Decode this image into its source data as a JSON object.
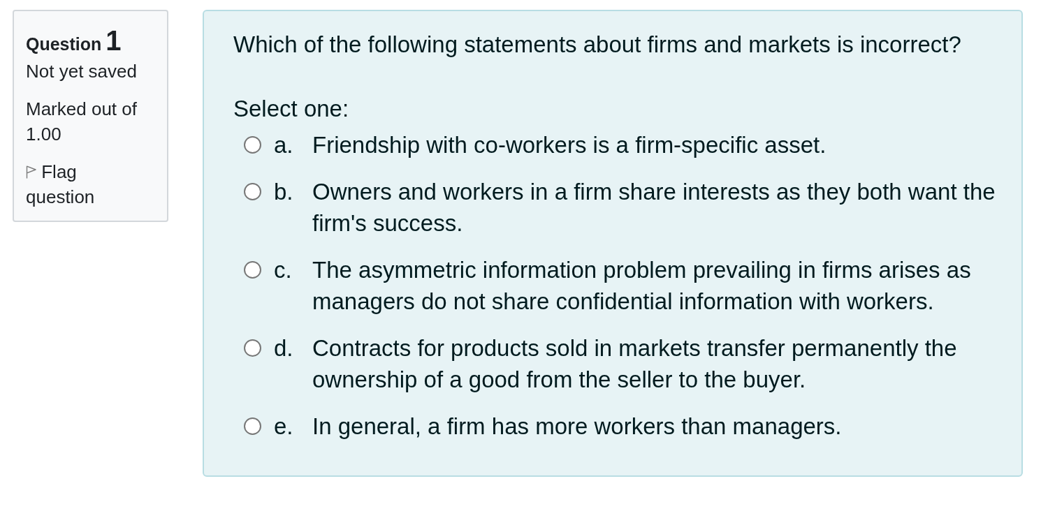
{
  "question_info": {
    "label": "Question",
    "number": "1",
    "status": "Not yet saved",
    "marks": "Marked out of 1.00",
    "flag": {
      "label": "Flag question",
      "flagged": false
    }
  },
  "question": {
    "text": "Which of the following statements about firms and markets is incorrect?",
    "prompt": "Select one:",
    "options": [
      {
        "letter": "a.",
        "text": "Friendship with co-workers is a firm-specific asset.",
        "selected": false
      },
      {
        "letter": "b.",
        "text": "Owners and workers in a firm share interests as they both want the firm's success.",
        "selected": false
      },
      {
        "letter": "c.",
        "text": "The asymmetric information problem prevailing in firms arises as managers do not share confidential information with workers.",
        "selected": false
      },
      {
        "letter": "d.",
        "text": "Contracts for products sold in markets transfer permanently the ownership of a good from the seller to the buyer.",
        "selected": false
      },
      {
        "letter": "e.",
        "text": "In general, a firm has more workers than managers.",
        "selected": false
      }
    ]
  }
}
